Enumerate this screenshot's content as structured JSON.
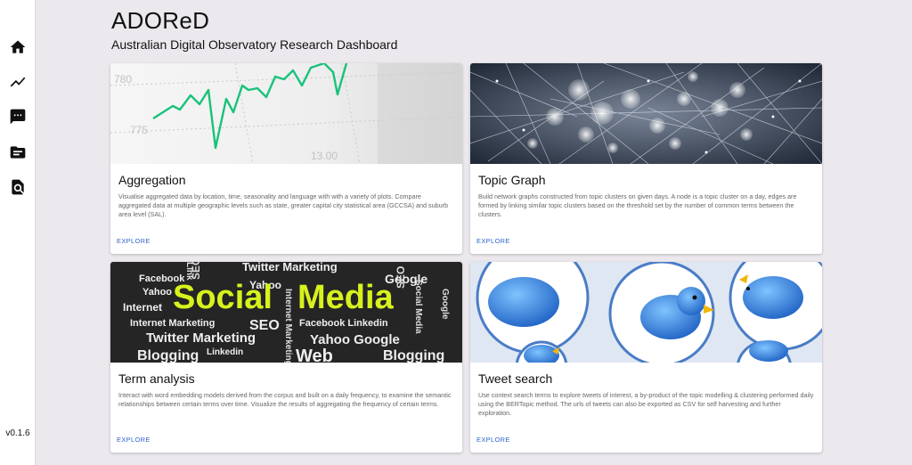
{
  "app": {
    "title": "ADOReD",
    "subtitle": "Australian Digital Observatory Research Dashboard",
    "version": "v0.1.6"
  },
  "sidebar": {
    "items": [
      {
        "icon": "home-icon"
      },
      {
        "icon": "trending-icon"
      },
      {
        "icon": "chat-icon"
      },
      {
        "icon": "folder-icon"
      },
      {
        "icon": "search-document-icon"
      }
    ]
  },
  "cards": [
    {
      "title": "Aggregation",
      "description": "Visualise aggregated data by location, time, seasonality and language with with a variety of plots. Compare aggregated data at multiple geographic levels such as state, greater capital city statistical area (GCCSA) and suburb area level (SAL).",
      "link": "EXPLORE",
      "image_text": [
        "780",
        "775",
        "13.00"
      ]
    },
    {
      "title": "Topic Graph",
      "description": "Build network graphs constructed from topic clusters on given days. A node is a topic cluster on a day, edges are formed by linking similar topic clusters based on the threshold set by the number of common terms between the clusters.",
      "link": "EXPLORE"
    },
    {
      "title": "Term analysis",
      "description": "Interact with word embedding models derived from the corpus and built on a daily frequency, to examine the semantic relationships between certain terms over time. Visualize the results of aggregating the frequency of certain terms.",
      "link": "EXPLORE",
      "image_text": {
        "big1": "Social",
        "big2": "Media",
        "words": [
          "Facebook",
          "Yahoo",
          "Internet",
          "Internet Marketing",
          "Twitter Marketing",
          "Blogging",
          "Linkedin",
          "SEO",
          "Twitter Marketing",
          "Yahoo Google",
          "Facebook Linkedin",
          "Web",
          "Blogging",
          "Yahoo",
          "Google",
          "Social Media",
          "Internet Marketing",
          "Link",
          "SEO",
          "SEO",
          "Google"
        ]
      }
    },
    {
      "title": "Tweet search",
      "description": "Use context search terms to explore tweets of interest, a by-product of the topic modelling & clustering performed daily using the BERTopic method. The urls of tweets can also be exported as CSV for self harvesting and further exploration.",
      "link": "EXPLORE"
    }
  ],
  "colors": {
    "background": "#ece9ee",
    "link": "#2f63c9",
    "chart_line": "#19c27a",
    "social_highlight": "#d7f21c",
    "twitter_blue": "#3a8ee6"
  }
}
